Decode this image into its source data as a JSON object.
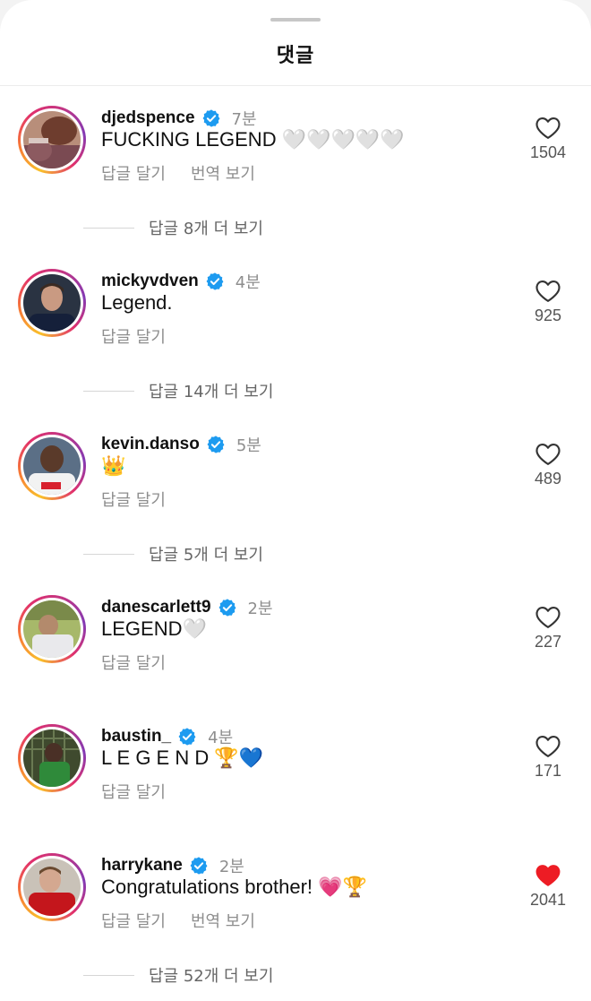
{
  "header": {
    "title": "댓글"
  },
  "reply_label": "답글 달기",
  "translate_label": "번역 보기",
  "colors": {
    "verified": "#1d9bf0",
    "liked_heart": "#ed1c24",
    "secondary_text": "#8e8e8e"
  },
  "comments": [
    {
      "username": "djedspence",
      "verified": true,
      "time": "7분",
      "text": "FUCKING LEGEND 🤍🤍🤍🤍🤍",
      "likes": "1504",
      "liked": false,
      "show_translate": true,
      "more_replies": "답글 8개 더 보기"
    },
    {
      "username": "mickyvdven",
      "verified": true,
      "time": "4분",
      "text": "Legend.",
      "likes": "925",
      "liked": false,
      "show_translate": false,
      "more_replies": "답글 14개 더 보기"
    },
    {
      "username": "kevin.danso",
      "verified": true,
      "time": "5분",
      "text": "👑",
      "likes": "489",
      "liked": false,
      "show_translate": false,
      "more_replies": "답글 5개 더 보기"
    },
    {
      "username": "danescarlett9",
      "verified": true,
      "time": "2분",
      "text": "LEGEND🤍",
      "likes": "227",
      "liked": false,
      "show_translate": false,
      "more_replies": ""
    },
    {
      "username": "baustin_",
      "verified": true,
      "time": "4분",
      "text": "L E G E N D 🏆💙",
      "likes": "171",
      "liked": false,
      "show_translate": false,
      "more_replies": ""
    },
    {
      "username": "harrykane",
      "verified": true,
      "time": "2분",
      "text": "Congratulations brother! 💗🏆",
      "likes": "2041",
      "liked": true,
      "show_translate": true,
      "more_replies": "답글 52개 더 보기"
    }
  ]
}
